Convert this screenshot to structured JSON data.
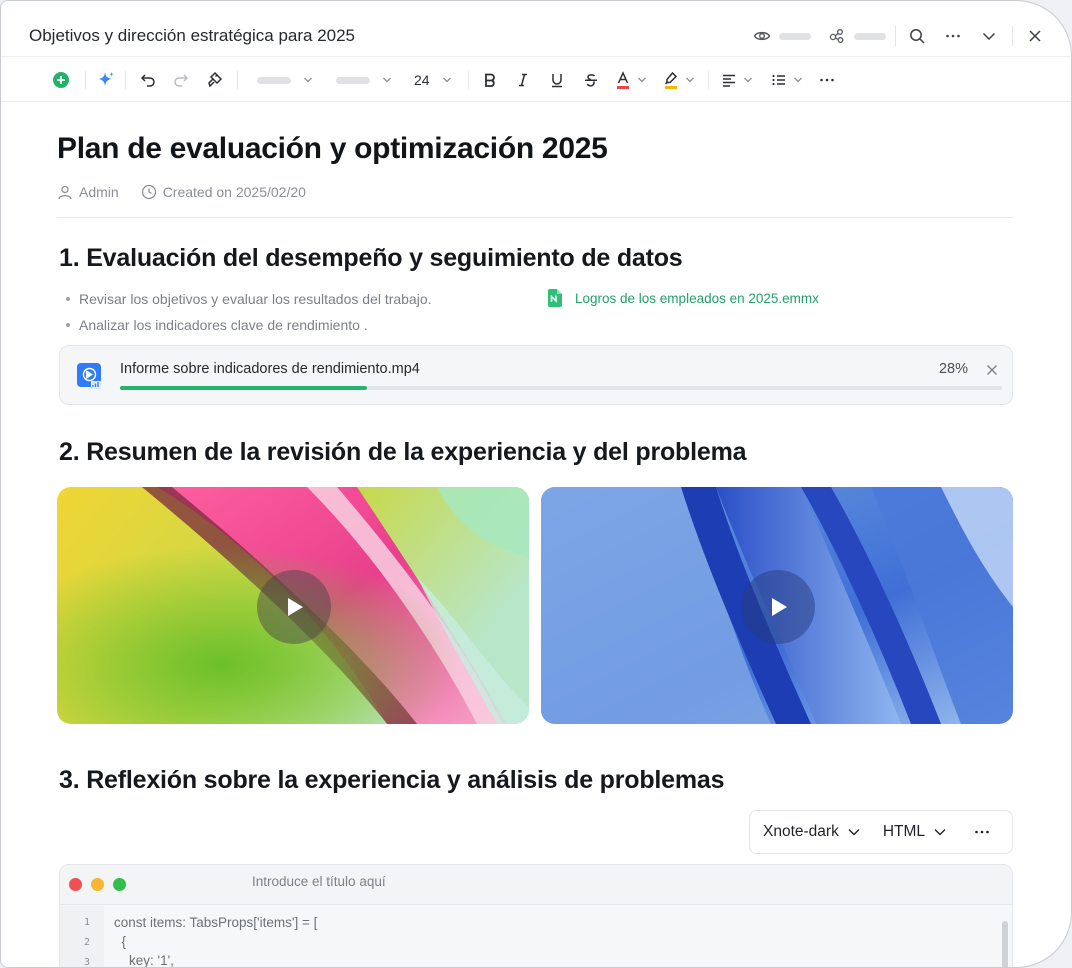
{
  "window": {
    "title": "Objetivos y dirección estratégica para 2025"
  },
  "toolbar": {
    "font_size": "24"
  },
  "doc": {
    "title": "Plan de evaluación y optimización 2025",
    "author": "Admin",
    "created": "Created on 2025/02/20"
  },
  "section1": {
    "heading": "1. Evaluación del desempeño y seguimiento de datos",
    "bullets": [
      "Revisar los objetivos y evaluar los resultados del trabajo.",
      "Analizar los indicadores clave de rendimiento ."
    ],
    "file_link": "Logros de los empleados en 2025.emmx",
    "upload": {
      "file_name": "Informe sobre indicadores de rendimiento.mp4",
      "percent_label": "28%",
      "progress": 0.28,
      "fill_color": "#27b36f"
    }
  },
  "section2": {
    "heading": "2. Resumen de la revisión de la experiencia y del problema"
  },
  "section3": {
    "heading": "3. Reflexión sobre la experiencia y análisis de problemas",
    "code_toolbar": {
      "theme": "Xnote-dark",
      "language": "HTML"
    },
    "code_window": {
      "title_placeholder": "Introduce el título aquí",
      "line_numbers": [
        "1",
        "2",
        "3"
      ],
      "lines": [
        "const items: TabsProps['items'] = [",
        "  {",
        "    key: '1',"
      ]
    }
  },
  "colors": {
    "accent_green": "#22a06b",
    "text_color_red": "#e5484d",
    "highlight_yellow": "#f5b800"
  }
}
